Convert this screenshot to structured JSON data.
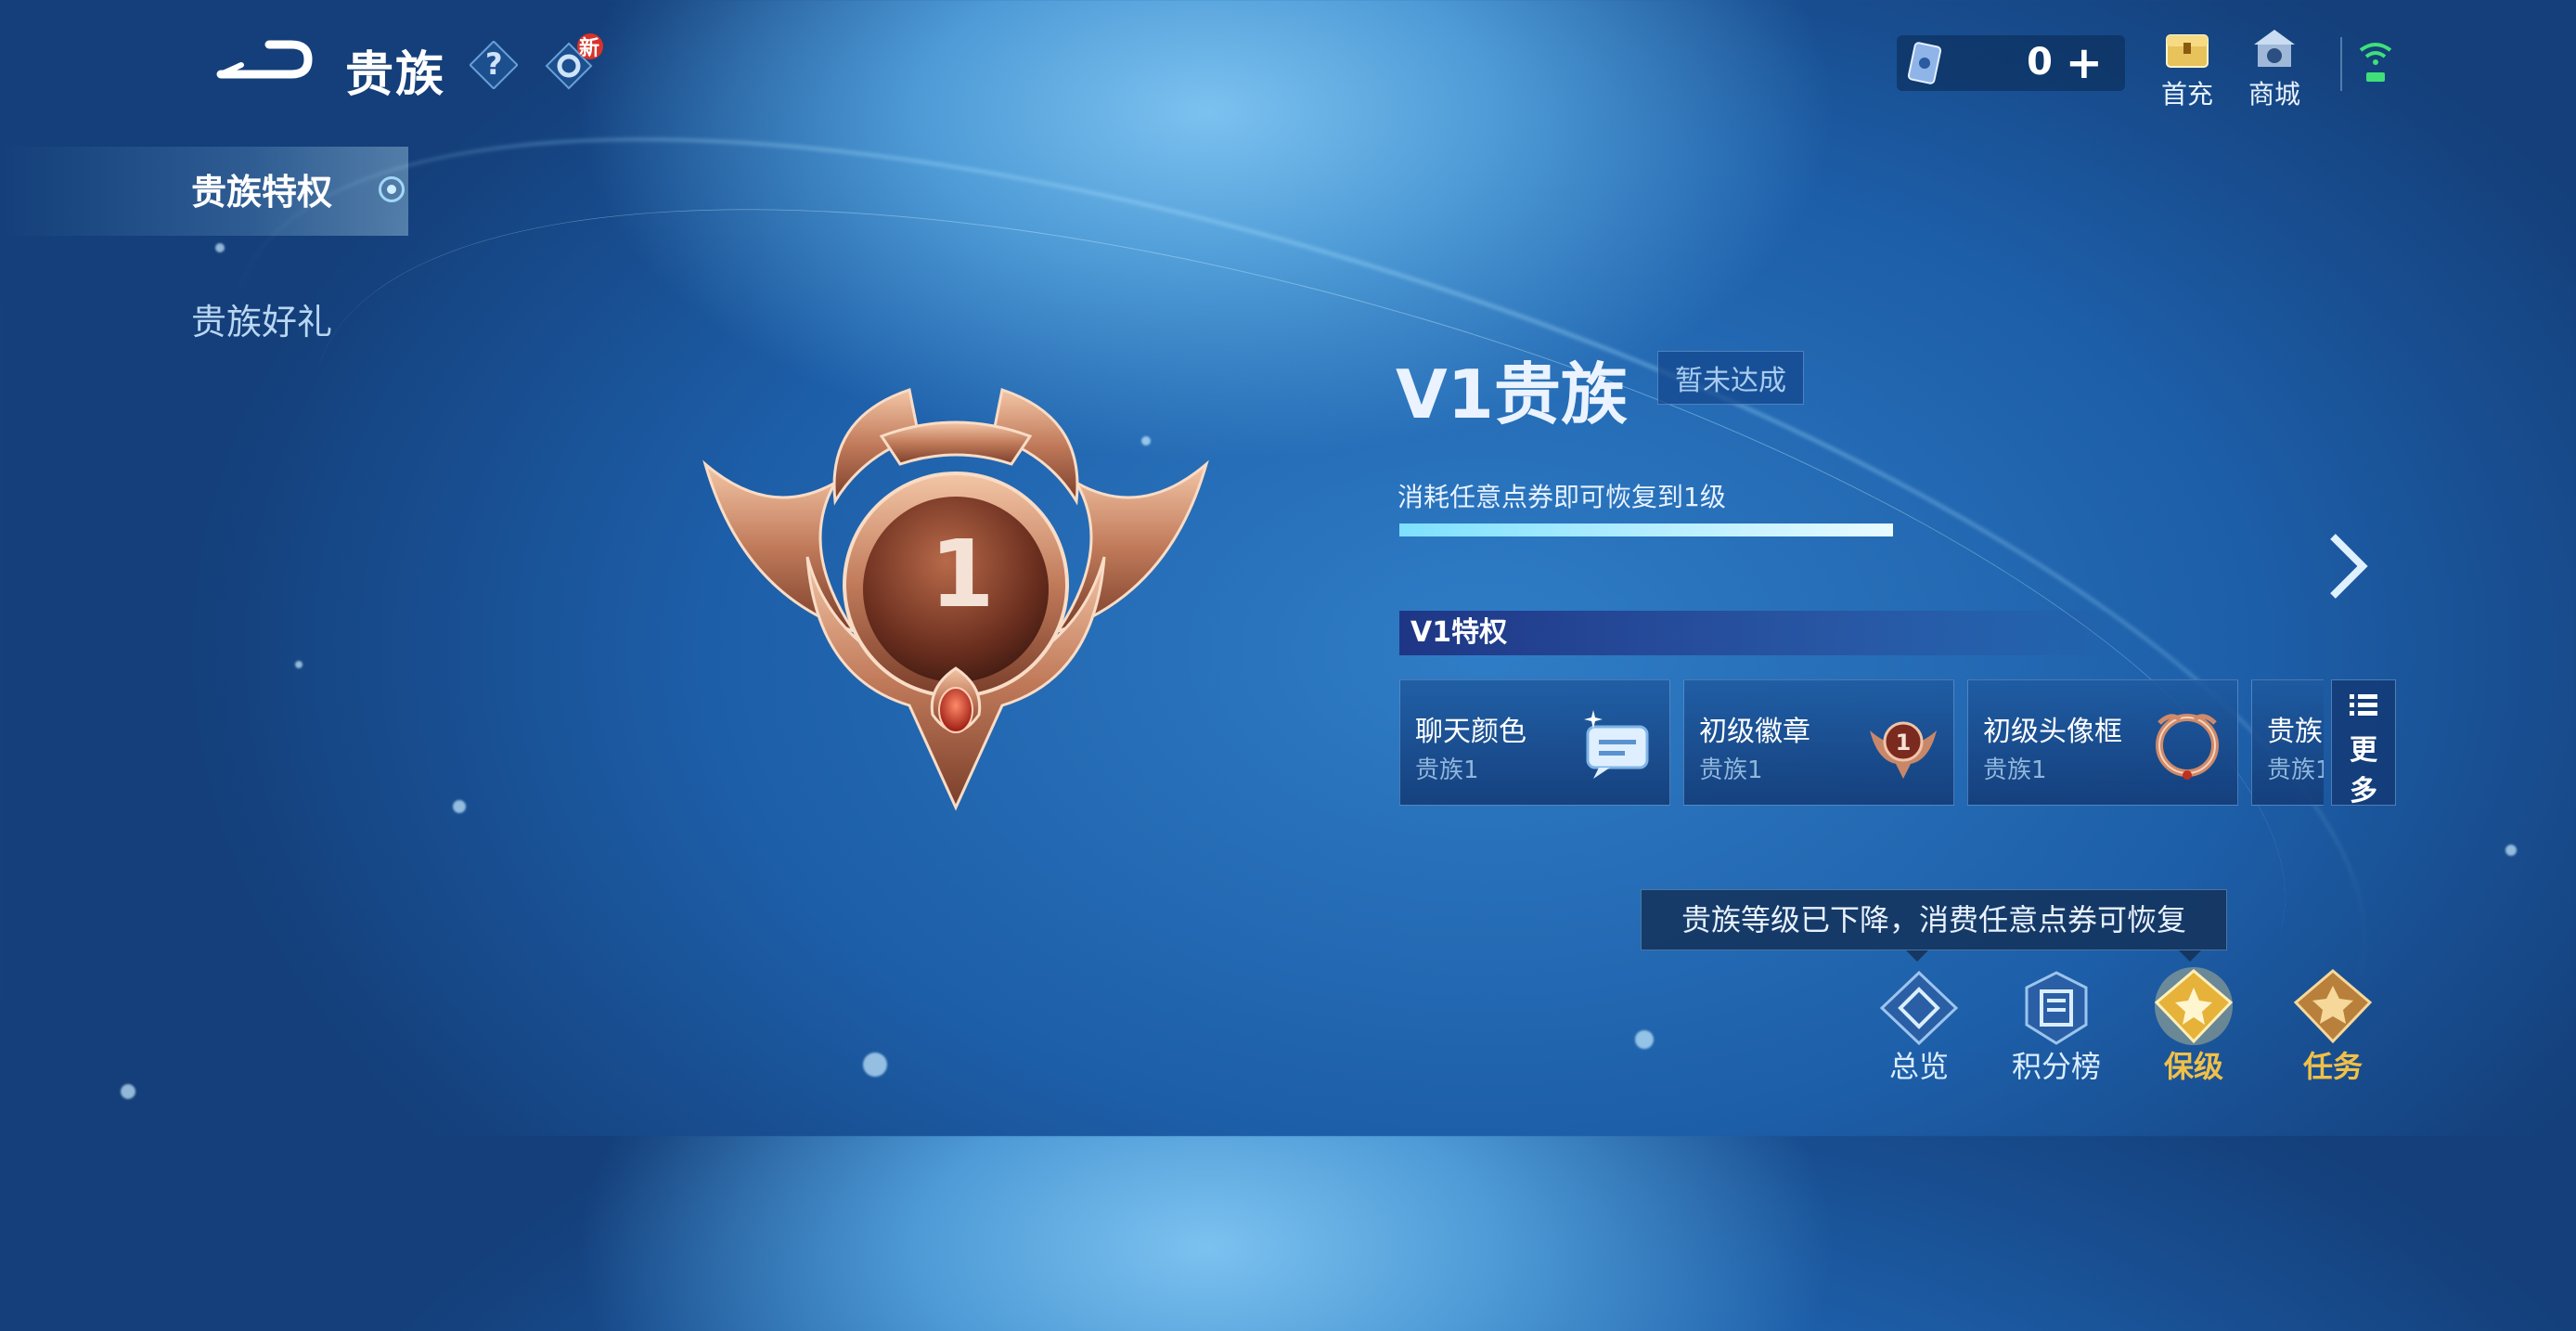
{
  "header": {
    "title": "贵族",
    "help_glyph": "?",
    "settings_badge": "新",
    "currency_value": "0",
    "currency_plus": "+",
    "first_recharge_label": "首充",
    "shop_label": "商城"
  },
  "sidebar": {
    "items": [
      {
        "label": "贵族特权",
        "active": true
      },
      {
        "label": "贵族好礼",
        "active": false
      }
    ]
  },
  "level": {
    "emblem_number": "1",
    "name": "V1贵族",
    "status": "暂未达成",
    "restore_text": "消耗任意点券即可恢复到1级",
    "progress": 1.0
  },
  "privileges": {
    "title": "V1特权",
    "cards": [
      {
        "name": "聊天颜色",
        "level": "贵族1",
        "icon": "chat-bubble-icon"
      },
      {
        "name": "初级徽章",
        "level": "贵族1",
        "icon": "badge-icon"
      },
      {
        "name": "初级头像框",
        "level": "贵族1",
        "icon": "avatar-frame-icon"
      },
      {
        "name": "贵族",
        "level": "贵族1",
        "icon": "unknown-icon"
      }
    ],
    "more_label_1": "更",
    "more_label_2": "多"
  },
  "tooltip": "贵族等级已下降，消费任意点券可恢复",
  "bottom_nav": [
    {
      "label": "总览",
      "icon": "overview-icon"
    },
    {
      "label": "积分榜",
      "icon": "leaderboard-icon"
    },
    {
      "label": "保级",
      "icon": "keep-level-icon"
    },
    {
      "label": "任务",
      "icon": "task-icon"
    }
  ],
  "colors": {
    "gold": "#f0c048",
    "accent_cyan": "#7ee0ff",
    "bronze": "#b86a4a"
  }
}
